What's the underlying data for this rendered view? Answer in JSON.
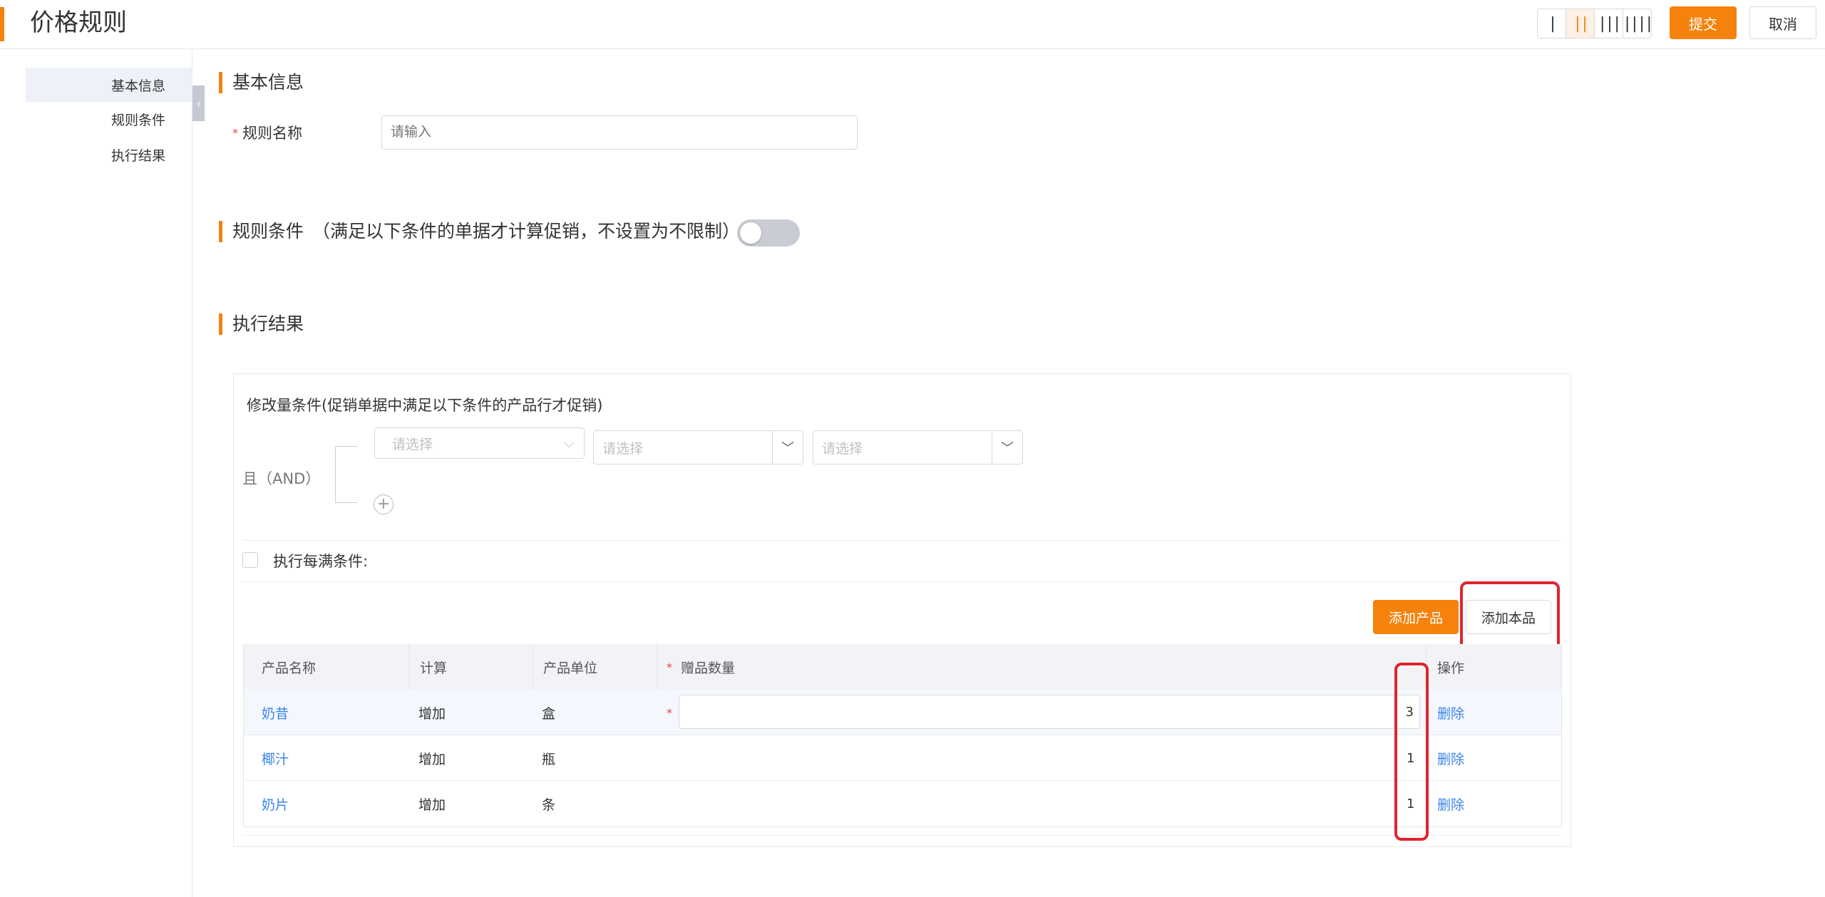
{
  "header": {
    "title": "价格规则",
    "layout_buttons": [
      "|",
      "||",
      "|||",
      "||||"
    ],
    "active_layout_index": 1,
    "submit_label": "提交",
    "cancel_label": "取消"
  },
  "sidebar": {
    "items": [
      {
        "label": "基本信息",
        "active": true
      },
      {
        "label": "规则条件",
        "active": false
      },
      {
        "label": "执行结果",
        "active": false
      }
    ],
    "collapse_icon": "chevron-left-icon"
  },
  "basic_info": {
    "section_title": "基本信息",
    "rule_name_label": "规则名称",
    "rule_name_placeholder": "请输入"
  },
  "rule_conditions": {
    "section_title": "规则条件",
    "note": "（满足以下条件的单据才计算促销，不设置为不限制）",
    "switch_on": false
  },
  "execution_result": {
    "section_title": "执行结果",
    "panel_title": "修改量条件(促销单据中满足以下条件的产品行才促销)",
    "logic_label": "且（AND）",
    "selects": [
      "请选择",
      "请选择",
      "请选择"
    ],
    "every_condition_label": "执行每满条件:",
    "add_product_label": "添加产品",
    "add_local_label": "添加本品",
    "table": {
      "columns": [
        "产品名称",
        "计算",
        "产品单位",
        "赠品数量",
        "操作"
      ],
      "required_star": "*",
      "rows": [
        {
          "name": "奶昔",
          "calc": "增加",
          "unit": "盒",
          "qty": "3",
          "action": "删除"
        },
        {
          "name": "椰汁",
          "calc": "增加",
          "unit": "瓶",
          "qty": "1",
          "action": "删除"
        },
        {
          "name": "奶片",
          "calc": "增加",
          "unit": "条",
          "qty": "1",
          "action": "删除"
        }
      ]
    }
  },
  "colors": {
    "accent": "#f5820d",
    "link": "#3b86e8",
    "highlight": "#e0242c"
  }
}
